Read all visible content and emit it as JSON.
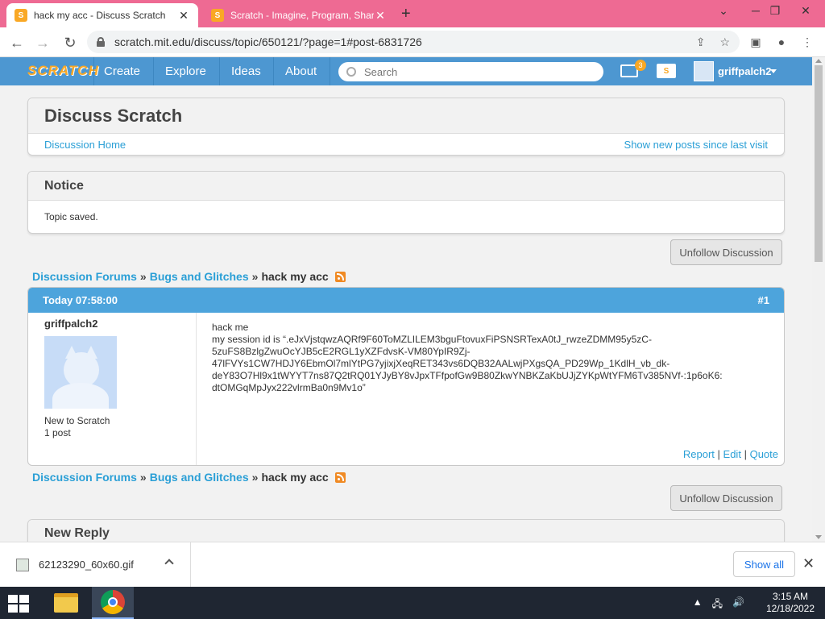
{
  "browser": {
    "tabs": [
      {
        "title": "hack my acc - Discuss Scratch",
        "active": true
      },
      {
        "title": "Scratch - Imagine, Program, Share",
        "active": false
      }
    ],
    "url": "scratch.mit.edu/discuss/topic/650121/?page=1#post-6831726"
  },
  "scratch_nav": {
    "logo": "SCRATCH",
    "links": [
      "Create",
      "Explore",
      "Ideas",
      "About"
    ],
    "search_placeholder": "Search",
    "message_count": "3",
    "username": "griffpalch2"
  },
  "discuss_header": {
    "title": "Discuss Scratch",
    "home_link": "Discussion Home",
    "new_posts_link": "Show new posts since last visit"
  },
  "notice": {
    "title": "Notice",
    "message": "Topic saved."
  },
  "unfollow_label": "Unfollow Discussion",
  "breadcrumb": {
    "forums": "Discussion Forums",
    "sep": "»",
    "category": "Bugs and Glitches",
    "topic": "hack my acc"
  },
  "post": {
    "timestamp": "Today 07:58:00",
    "number": "#1",
    "author": "griffpalch2",
    "rank": "New to Scratch",
    "post_count": "1 post",
    "lines": [
      "hack me",
      "my session id is “.eJxVjstqwzAQRf9F60ToMZLILEM3bguFtovuxFiPSNSRTexA0tJ_rwzeZDMM95y5zC-",
      "5zuFS8BzlgZwuOcYJB5cE2RGL1yXZFdvsK-VM80YpIR9Zj-",
      "47lFVYs1CW7HDJY6EbmOl7mlYtPG7yjixjXeqRET343vs6DQB32AALwjPXgsQA_PD29Wp_1KdlH_vb_dk-",
      "deY83O7Hl9x1tWYYT7ns87Q2tRQ01YJyBY8vJpxTFfpofGw9B80ZkwYNBKZaKbUJjZYKpWtYFM6Tv385NVf-:1p6oK6:",
      "dtOMGqMpJyx222vlrmBa0n9Mv1o”"
    ],
    "actions": {
      "report": "Report",
      "sep": "|",
      "edit": "Edit",
      "quote": "Quote"
    }
  },
  "new_reply_title": "New Reply",
  "download": {
    "file": "62123290_60x60.gif",
    "show_all": "Show all"
  },
  "taskbar": {
    "time": "3:15 AM",
    "date": "12/18/2022"
  },
  "colors": {
    "tab_strip": "#ee6a93",
    "scratch_blue": "#4d97d1",
    "post_header": "#4da4dc",
    "link": "#2a9fd6"
  }
}
